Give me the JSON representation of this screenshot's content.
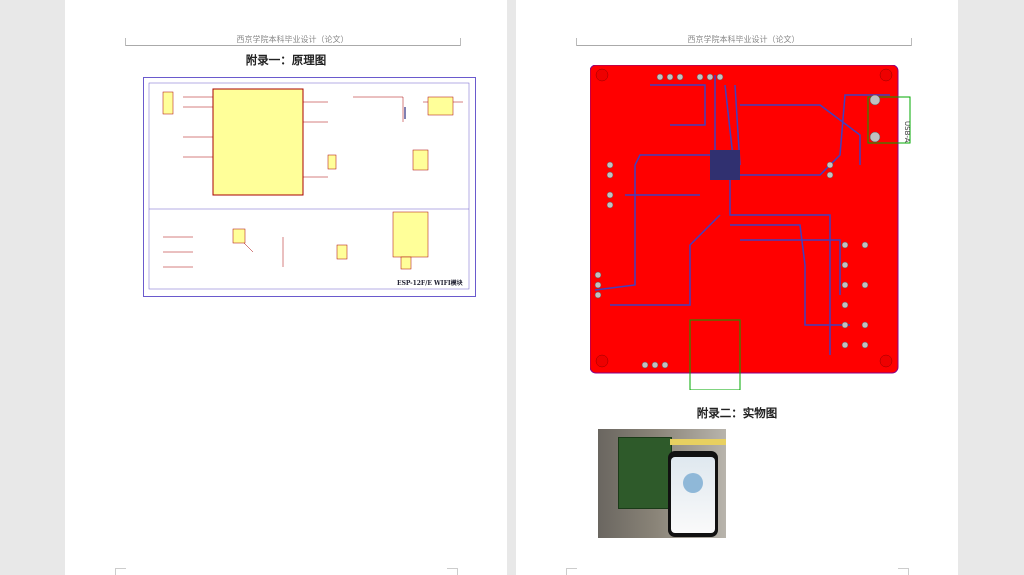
{
  "pages": [
    {
      "header": "西京学院本科毕业设计（论文）",
      "title": "附录一：原理图",
      "figure_label": "ESP-12F/E WIFI模块"
    },
    {
      "header": "西京学院本科毕业设计（论文）",
      "title": "附录二：实物图",
      "pcb_label": "USB-A"
    }
  ],
  "colors": {
    "pcb_board": "#ff0000",
    "pcb_trace": "#4040c0",
    "pcb_pad": "#c0c0c0",
    "schematic_mcu": "#ffff99",
    "schematic_border": "#6a5acd"
  }
}
